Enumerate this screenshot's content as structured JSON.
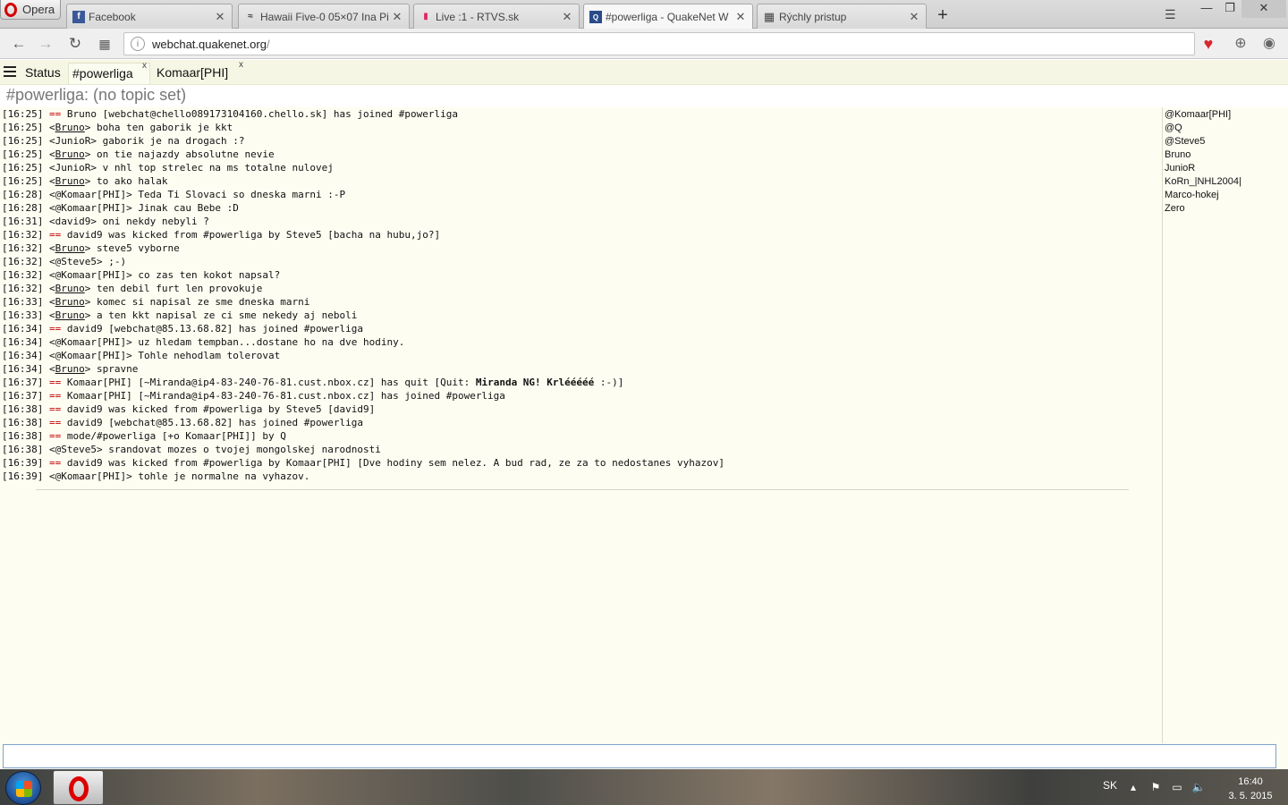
{
  "browser": {
    "menu_label": "Opera",
    "tabs": [
      {
        "label": "Facebook",
        "icon": "facebook-icon"
      },
      {
        "label": "Hawaii Five-0 05×07 Ina Pi",
        "icon": "video-icon"
      },
      {
        "label": "Live :1 - RTVS.sk",
        "icon": "rtvs-icon"
      },
      {
        "label": "#powerliga - QuakeNet W",
        "icon": "quakenet-icon",
        "active": true
      },
      {
        "label": "Rýchly pristup",
        "icon": "grid-icon"
      }
    ],
    "url_host": "webchat.quakenet.org",
    "url_path": "/"
  },
  "chat": {
    "tabs": [
      {
        "label": "Status",
        "closable": false
      },
      {
        "label": "#powerliga",
        "closable": true,
        "active": true
      },
      {
        "label": "Komaar[PHI]",
        "closable": true
      }
    ],
    "close_glyph": "x",
    "topic": "#powerliga: (no topic set)",
    "log": [
      {
        "time": "[16:25]",
        "kind": "sys",
        "prefix": "==",
        "text": " Bruno [webchat@chello089173104160.chello.sk] has joined #powerliga"
      },
      {
        "time": "[16:25]",
        "kind": "msg",
        "nick": "Bruno",
        "link": true,
        "text": " boha ten gaborik je kkt"
      },
      {
        "time": "[16:25]",
        "kind": "msg",
        "nick": "JunioR",
        "link": false,
        "text": " gaborik je na drogach :?"
      },
      {
        "time": "[16:25]",
        "kind": "msg",
        "nick": "Bruno",
        "link": true,
        "text": " on tie najazdy absolutne nevie"
      },
      {
        "time": "[16:25]",
        "kind": "msg",
        "nick": "JunioR",
        "link": false,
        "text": " v nhl top strelec na ms totalne nulovej"
      },
      {
        "time": "[16:25]",
        "kind": "msg",
        "nick": "Bruno",
        "link": true,
        "text": " to ako halak"
      },
      {
        "time": "[16:28]",
        "kind": "msg",
        "nick": "@Komaar[PHI]",
        "link": false,
        "text": " Teda Ti Slovaci so dneska marni :-P"
      },
      {
        "time": "[16:28]",
        "kind": "msg",
        "nick": "@Komaar[PHI]",
        "link": false,
        "text": " Jinak cau Bebe :D"
      },
      {
        "time": "[16:31]",
        "kind": "msg",
        "nick": "david9",
        "link": false,
        "text": " oni nekdy nebyli ?"
      },
      {
        "time": "[16:32]",
        "kind": "sys",
        "prefix": "==",
        "text": " david9 was kicked from #powerliga by Steve5 [bacha na hubu,jo?]"
      },
      {
        "time": "[16:32]",
        "kind": "msg",
        "nick": "Bruno",
        "link": true,
        "text": " steve5 vyborne"
      },
      {
        "time": "[16:32]",
        "kind": "msg",
        "nick": "@Steve5",
        "link": false,
        "text": " ;-)"
      },
      {
        "time": "[16:32]",
        "kind": "msg",
        "nick": "@Komaar[PHI]",
        "link": false,
        "text": " co zas ten kokot napsal?"
      },
      {
        "time": "[16:32]",
        "kind": "msg",
        "nick": "Bruno",
        "link": true,
        "text": " ten debil furt len provokuje"
      },
      {
        "time": "[16:33]",
        "kind": "msg",
        "nick": "Bruno",
        "link": true,
        "text": " komec si napisal ze sme dneska marni"
      },
      {
        "time": "[16:33]",
        "kind": "msg",
        "nick": "Bruno",
        "link": true,
        "text": " a ten kkt napisal ze ci sme nekedy aj neboli"
      },
      {
        "time": "[16:34]",
        "kind": "sys",
        "prefix": "==",
        "text": " david9 [webchat@85.13.68.82] has joined #powerliga"
      },
      {
        "time": "[16:34]",
        "kind": "msg",
        "nick": "@Komaar[PHI]",
        "link": false,
        "text": " uz hledam tempban...dostane ho na dve hodiny."
      },
      {
        "time": "[16:34]",
        "kind": "msg",
        "nick": "@Komaar[PHI]",
        "link": false,
        "text": " Tohle nehodlam tolerovat"
      },
      {
        "time": "[16:34]",
        "kind": "msg",
        "nick": "Bruno",
        "link": true,
        "text": " spravne"
      },
      {
        "time": "[16:37]",
        "kind": "sys",
        "prefix": "==",
        "text": " Komaar[PHI] [~Miranda@ip4-83-240-76-81.cust.nbox.cz] has quit [Quit: ",
        "bold": "Miranda NG! Krlééééé",
        "tail": " :-)]"
      },
      {
        "time": "[16:37]",
        "kind": "sys",
        "prefix": "==",
        "text": " Komaar[PHI] [~Miranda@ip4-83-240-76-81.cust.nbox.cz] has joined #powerliga"
      },
      {
        "time": "[16:38]",
        "kind": "sys",
        "prefix": "==",
        "text": " david9 was kicked from #powerliga by Steve5 [david9]"
      },
      {
        "time": "[16:38]",
        "kind": "sys",
        "prefix": "==",
        "text": " david9 [webchat@85.13.68.82] has joined #powerliga"
      },
      {
        "time": "[16:38]",
        "kind": "sys",
        "prefix": "==",
        "text": " mode/#powerliga [+o Komaar[PHI]] by Q"
      },
      {
        "time": "[16:38]",
        "kind": "msg",
        "nick": "@Steve5",
        "link": false,
        "text": " srandovat mozes o tvojej mongolskej narodnosti"
      },
      {
        "time": "[16:39]",
        "kind": "sys",
        "prefix": "==",
        "text": " david9 was kicked from #powerliga by Komaar[PHI] [Dve hodiny sem nelez. A bud rad, ze za to nedostanes vyhazov]"
      },
      {
        "time": "[16:39]",
        "kind": "msg",
        "nick": "@Komaar[PHI]",
        "link": false,
        "text": " tohle je normalne na vyhazov."
      }
    ],
    "nicklist": [
      "@Komaar[PHI]",
      "@Q",
      "@Steve5",
      "Bruno",
      "JunioR",
      "KoRn_|NHL2004|",
      "Marco-hokej",
      "Zero"
    ],
    "input_value": ""
  },
  "taskbar": {
    "language": "SK",
    "time": "16:40",
    "date": "3. 5. 2015"
  },
  "colors": {
    "chat_background": "#fdfdf2",
    "system_message": "#c00000",
    "tabbar_background": "#f5f7e4"
  }
}
